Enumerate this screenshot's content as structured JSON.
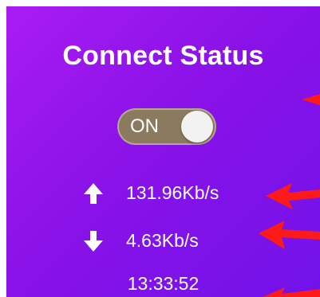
{
  "window": {
    "title": "Connect Status"
  },
  "toggle": {
    "label": "ON",
    "state": "on"
  },
  "stats": {
    "upload": {
      "value": "131.96Kb/s",
      "icon": "arrow-up-icon"
    },
    "download": {
      "value": "4.63Kb/s",
      "icon": "arrow-down-icon"
    }
  },
  "clock": {
    "time": "13:33:52"
  },
  "colors": {
    "gradient_start": "#a91cf2",
    "gradient_end": "#7112ea",
    "toggle_track": "#8b7a5d",
    "annotation": "#ff1a1a"
  }
}
